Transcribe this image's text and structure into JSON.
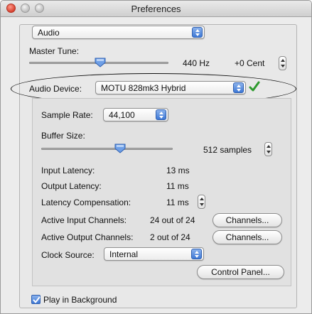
{
  "window": {
    "title": "Preferences"
  },
  "section_popup": {
    "value": "Audio"
  },
  "master_tune": {
    "label": "Master Tune:",
    "hz": "440 Hz",
    "cent": "+0 Cent",
    "slider_fraction": 0.48
  },
  "audio_device": {
    "label": "Audio Device:",
    "value": "MOTU 828mk3 Hybrid"
  },
  "sample_rate": {
    "label": "Sample Rate:",
    "value": "44,100"
  },
  "buffer_size": {
    "label": "Buffer Size:",
    "value": "512 samples",
    "slider_fraction": 0.6
  },
  "latency": {
    "input_label": "Input Latency:",
    "input_value": "13 ms",
    "output_label": "Output Latency:",
    "output_value": "11 ms",
    "comp_label": "Latency Compensation:",
    "comp_value": "11 ms"
  },
  "channels": {
    "input_label": "Active Input Channels:",
    "input_value": "24 out of 24",
    "output_label": "Active Output Channels:",
    "output_value": "2 out of 24",
    "button_label": "Channels..."
  },
  "clock_source": {
    "label": "Clock Source:",
    "value": "Internal"
  },
  "control_panel": {
    "label": "Control Panel..."
  },
  "play_in_background": {
    "label": "Play in Background",
    "checked": true
  },
  "colors": {
    "accent": "#3d78d6",
    "checkmark": "#2e9a2e",
    "close_button": "#d7412f"
  }
}
